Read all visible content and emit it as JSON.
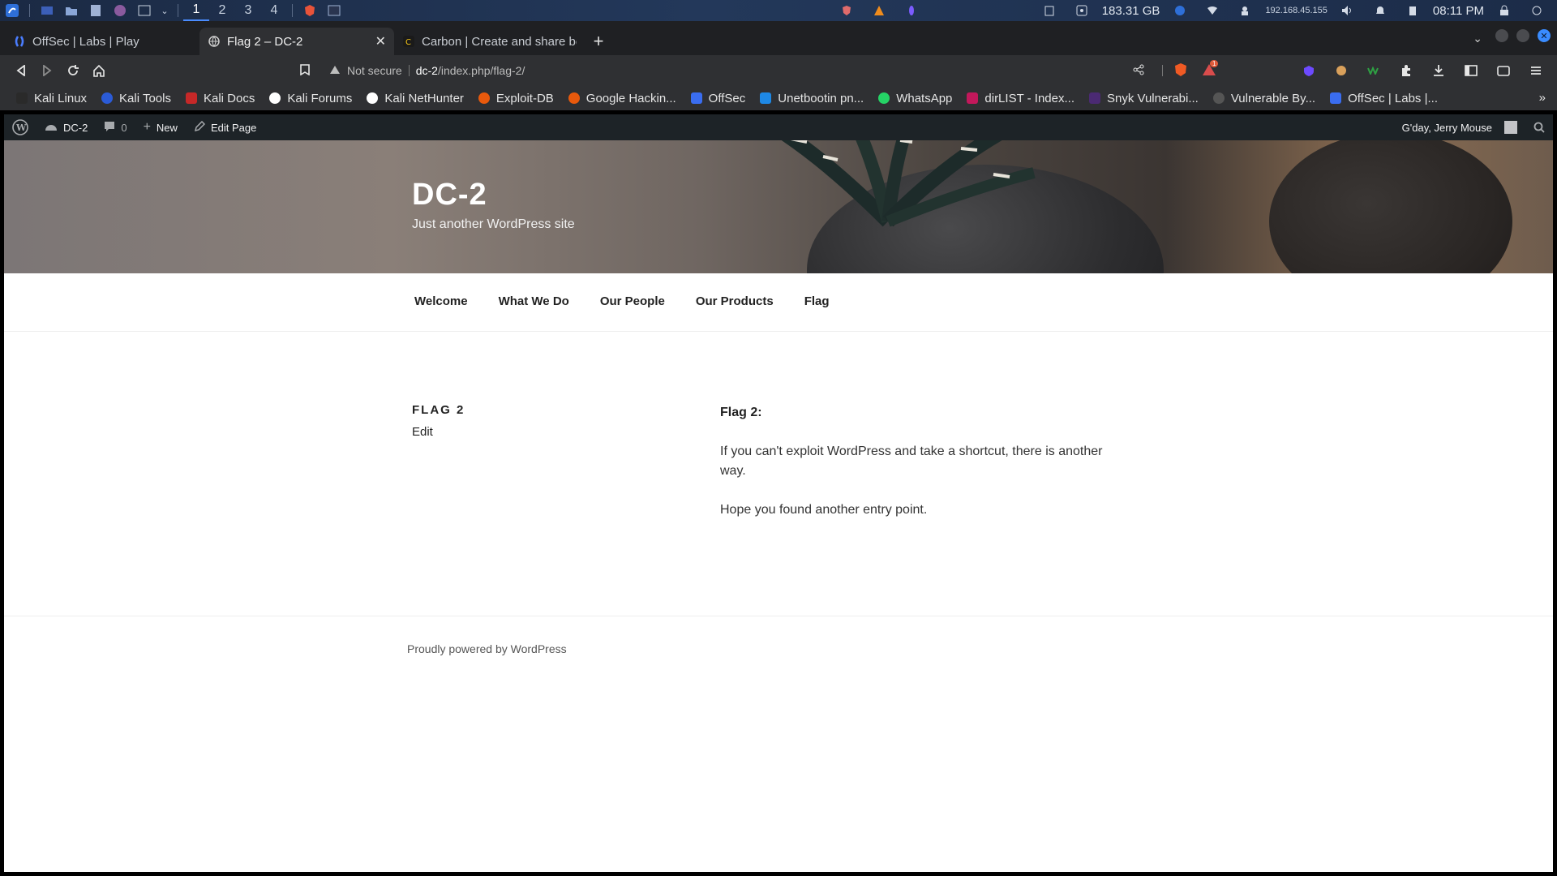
{
  "os_panel": {
    "workspaces": [
      "1",
      "2",
      "3",
      "4"
    ],
    "disk": "183.31 GB",
    "ip": "192.168.45.155",
    "clock": "08:11 PM"
  },
  "browser": {
    "tabs": [
      {
        "title": "OffSec | Labs | Play",
        "icon": "offsec-icon"
      },
      {
        "title": "Flag 2 – DC-2",
        "icon": "globe-icon"
      },
      {
        "title": "Carbon | Create and share bea",
        "icon": "carbon-icon"
      }
    ],
    "url": {
      "security": "Not secure",
      "host": "dc-2",
      "path": "/index.php/flag-2/"
    },
    "brave_badge": "1",
    "bookmarks": [
      {
        "label": "Kali Linux",
        "color": "#2a2a2a"
      },
      {
        "label": "Kali Tools",
        "color": "#2b5bd7"
      },
      {
        "label": "Kali Docs",
        "color": "#c62828"
      },
      {
        "label": "Kali Forums",
        "color": "#ffffff"
      },
      {
        "label": "Kali NetHunter",
        "color": "#ffffff"
      },
      {
        "label": "Exploit-DB",
        "color": "#e8590c"
      },
      {
        "label": "Google Hackin...",
        "color": "#e8590c"
      },
      {
        "label": "OffSec",
        "color": "#3a6df0"
      },
      {
        "label": "Unetbootin pn...",
        "color": "#1e88e5"
      },
      {
        "label": "WhatsApp",
        "color": "#25d366"
      },
      {
        "label": "dirLIST - Index...",
        "color": "#c2185b"
      },
      {
        "label": "Snyk Vulnerabi...",
        "color": "#4b2a73"
      },
      {
        "label": "Vulnerable By...",
        "color": "#555555"
      },
      {
        "label": "OffSec | Labs |...",
        "color": "#3a6df0"
      }
    ]
  },
  "wp_admin_bar": {
    "site": "DC-2",
    "comments": "0",
    "new": "New",
    "edit_page": "Edit Page",
    "greeting": "G'day, Jerry Mouse"
  },
  "site": {
    "title": "DC-2",
    "description": "Just another WordPress site",
    "nav": [
      "Welcome",
      "What We Do",
      "Our People",
      "Our Products",
      "Flag"
    ]
  },
  "post": {
    "title": "FLAG 2",
    "edit": "Edit",
    "heading": "Flag 2:",
    "paragraphs": [
      "If you can't exploit WordPress and take a shortcut, there is another way.",
      "Hope you found another entry point."
    ]
  },
  "footer": {
    "powered": "Proudly powered by WordPress"
  }
}
